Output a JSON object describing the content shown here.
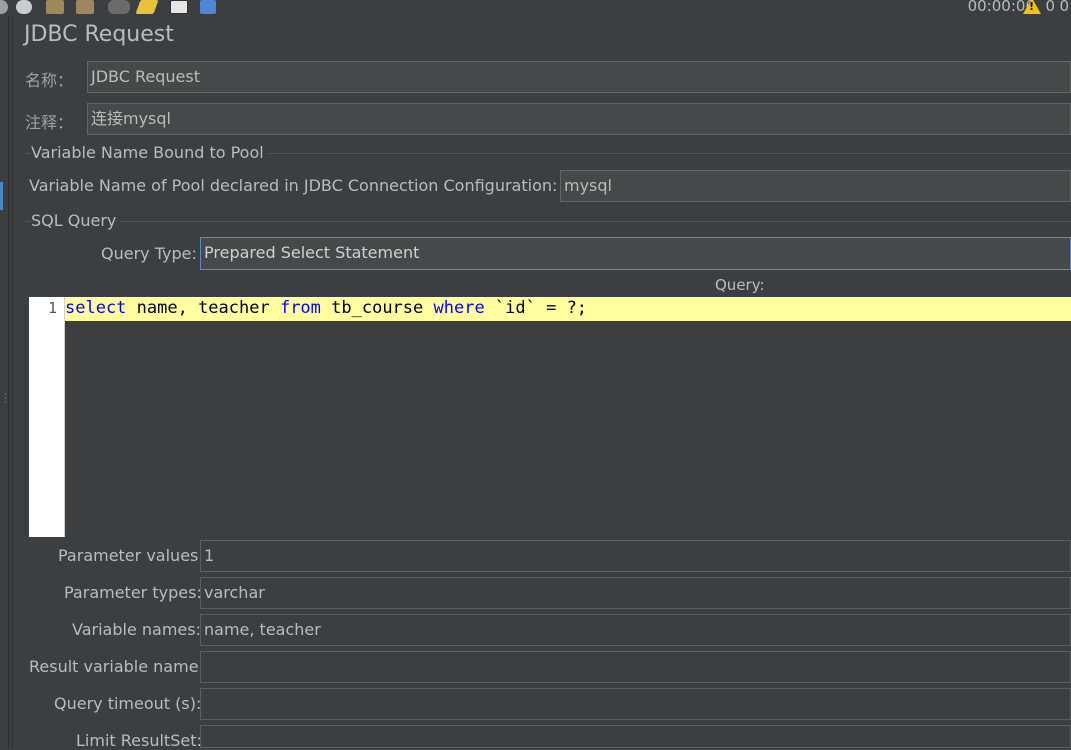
{
  "toolbar": {
    "icons": [
      "stop-icon",
      "shutdown-icon",
      "clear-icon",
      "clear-all-icon",
      "search-icon",
      "reset-search-icon",
      "function-helper-icon",
      "help-icon"
    ],
    "timer": "00:00:00",
    "warning_count": "0",
    "error_count": "0"
  },
  "panel": {
    "title": "JDBC Request",
    "name_label": "名称：",
    "name_value": "JDBC Request",
    "comment_label": "注释：",
    "comment_value": "连接mysql"
  },
  "pool": {
    "section_title": "Variable Name Bound to Pool",
    "label": "Variable Name of Pool declared in JDBC Connection Configuration:",
    "value": "mysql"
  },
  "sql": {
    "section_title": "SQL Query",
    "query_type_label": "Query Type:",
    "query_type_value": "Prepared Select Statement",
    "query_label": "Query:",
    "line_number": "1",
    "code_tokens": [
      {
        "t": "select",
        "kw": true
      },
      {
        "t": " name, teacher ",
        "kw": false
      },
      {
        "t": "from",
        "kw": true
      },
      {
        "t": " tb_course ",
        "kw": false
      },
      {
        "t": "where",
        "kw": true
      },
      {
        "t": " `id` = ?;",
        "kw": false
      }
    ]
  },
  "params": {
    "parameter_values_label": "Parameter values:",
    "parameter_values": "1",
    "parameter_types_label": "Parameter types:",
    "parameter_types": "varchar",
    "variable_names_label": "Variable names:",
    "variable_names": "name, teacher",
    "result_variable_label": "Result variable name:",
    "result_variable": "",
    "query_timeout_label": "Query timeout (s):",
    "query_timeout": "",
    "limit_resultset_label": "Limit ResultSet:",
    "limit_resultset": ""
  },
  "colors": {
    "background": "#3c3f41",
    "field": "#45494a",
    "current_line": "#ffffa0",
    "keyword": "#0000ff",
    "focus_border": "#5c8bc4"
  }
}
